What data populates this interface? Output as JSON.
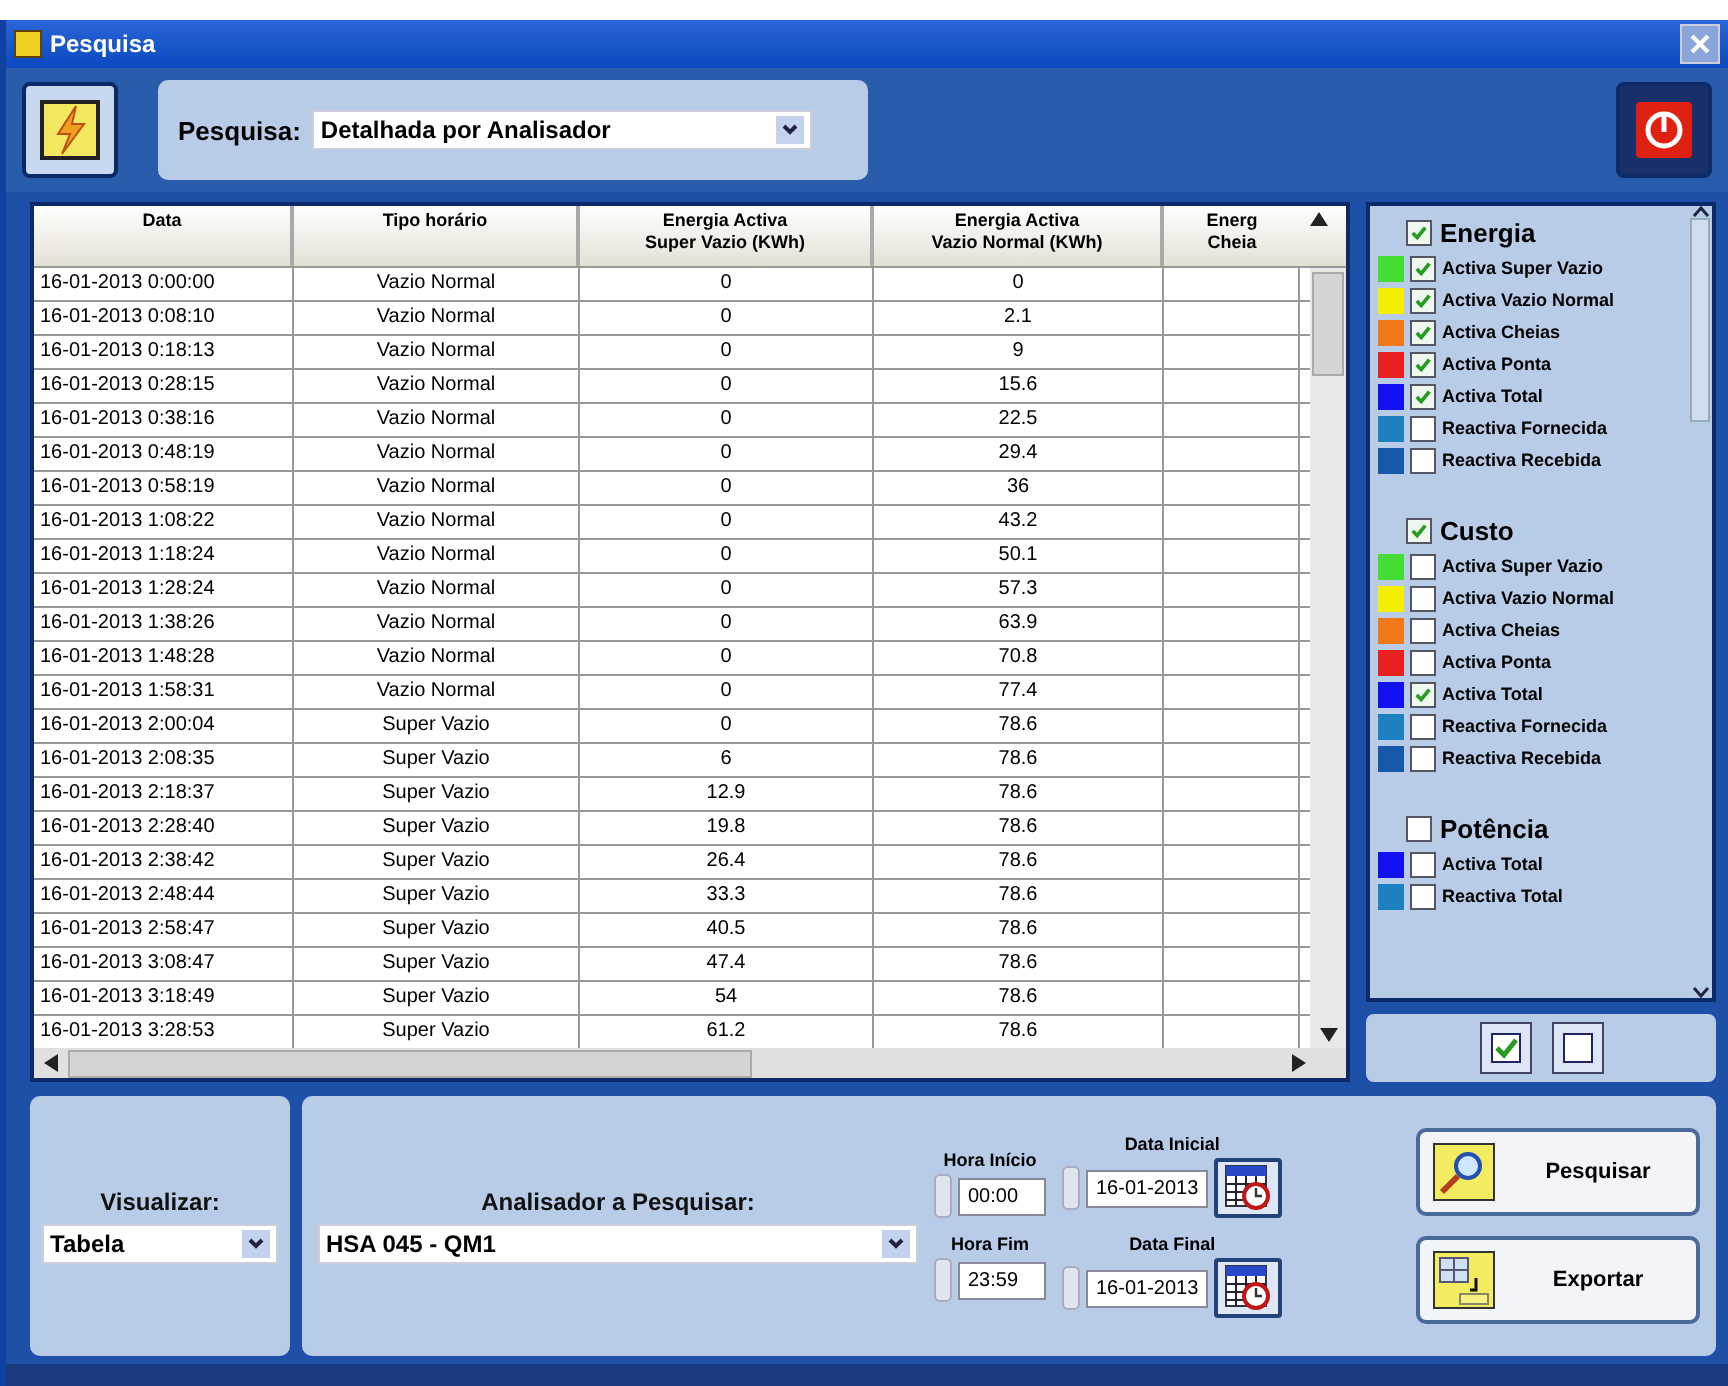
{
  "window": {
    "title": "Pesquisa"
  },
  "toolbar": {
    "label": "Pesquisa:",
    "value": "Detalhada por Analisador"
  },
  "table": {
    "columns": [
      "Data",
      "Tipo horário",
      "Energia Activa\nSuper Vazio (KWh)",
      "Energia Activa\nVazio Normal (KWh)",
      "Energ\nCheia"
    ],
    "rows": [
      [
        "16-01-2013 0:00:00",
        "Vazio Normal",
        "0",
        "0"
      ],
      [
        "16-01-2013 0:08:10",
        "Vazio Normal",
        "0",
        "2.1"
      ],
      [
        "16-01-2013 0:18:13",
        "Vazio Normal",
        "0",
        "9"
      ],
      [
        "16-01-2013 0:28:15",
        "Vazio Normal",
        "0",
        "15.6"
      ],
      [
        "16-01-2013 0:38:16",
        "Vazio Normal",
        "0",
        "22.5"
      ],
      [
        "16-01-2013 0:48:19",
        "Vazio Normal",
        "0",
        "29.4"
      ],
      [
        "16-01-2013 0:58:19",
        "Vazio Normal",
        "0",
        "36"
      ],
      [
        "16-01-2013 1:08:22",
        "Vazio Normal",
        "0",
        "43.2"
      ],
      [
        "16-01-2013 1:18:24",
        "Vazio Normal",
        "0",
        "50.1"
      ],
      [
        "16-01-2013 1:28:24",
        "Vazio Normal",
        "0",
        "57.3"
      ],
      [
        "16-01-2013 1:38:26",
        "Vazio Normal",
        "0",
        "63.9"
      ],
      [
        "16-01-2013 1:48:28",
        "Vazio Normal",
        "0",
        "70.8"
      ],
      [
        "16-01-2013 1:58:31",
        "Vazio Normal",
        "0",
        "77.4"
      ],
      [
        "16-01-2013 2:00:04",
        "Super Vazio",
        "0",
        "78.6"
      ],
      [
        "16-01-2013 2:08:35",
        "Super Vazio",
        "6",
        "78.6"
      ],
      [
        "16-01-2013 2:18:37",
        "Super Vazio",
        "12.9",
        "78.6"
      ],
      [
        "16-01-2013 2:28:40",
        "Super Vazio",
        "19.8",
        "78.6"
      ],
      [
        "16-01-2013 2:38:42",
        "Super Vazio",
        "26.4",
        "78.6"
      ],
      [
        "16-01-2013 2:48:44",
        "Super Vazio",
        "33.3",
        "78.6"
      ],
      [
        "16-01-2013 2:58:47",
        "Super Vazio",
        "40.5",
        "78.6"
      ],
      [
        "16-01-2013 3:08:47",
        "Super Vazio",
        "47.4",
        "78.6"
      ],
      [
        "16-01-2013 3:18:49",
        "Super Vazio",
        "54",
        "78.6"
      ],
      [
        "16-01-2013 3:28:53",
        "Super Vazio",
        "61.2",
        "78.6"
      ]
    ]
  },
  "legend": [
    {
      "title": "Energia",
      "checked": true,
      "items": [
        {
          "label": "Activa Super Vazio",
          "checked": true,
          "color": "#44dd33"
        },
        {
          "label": "Activa Vazio Normal",
          "checked": true,
          "color": "#f4ee00"
        },
        {
          "label": "Activa Cheias",
          "checked": true,
          "color": "#f07818"
        },
        {
          "label": "Activa Ponta",
          "checked": true,
          "color": "#e82020"
        },
        {
          "label": "Activa Total",
          "checked": true,
          "color": "#1010f0"
        },
        {
          "label": "Reactiva Fornecida",
          "checked": false,
          "color": "#1c80c0"
        },
        {
          "label": "Reactiva Recebida",
          "checked": false,
          "color": "#1858a8"
        }
      ]
    },
    {
      "title": "Custo",
      "checked": true,
      "items": [
        {
          "label": "Activa Super Vazio",
          "checked": false,
          "color": "#44dd33"
        },
        {
          "label": "Activa Vazio Normal",
          "checked": false,
          "color": "#f4ee00"
        },
        {
          "label": "Activa Cheias",
          "checked": false,
          "color": "#f07818"
        },
        {
          "label": "Activa Ponta",
          "checked": false,
          "color": "#e82020"
        },
        {
          "label": "Activa Total",
          "checked": true,
          "color": "#1010f0"
        },
        {
          "label": "Reactiva Fornecida",
          "checked": false,
          "color": "#1c80c0"
        },
        {
          "label": "Reactiva Recebida",
          "checked": false,
          "color": "#1858a8"
        }
      ]
    },
    {
      "title": "Potência",
      "checked": false,
      "items": [
        {
          "label": "Activa Total",
          "checked": false,
          "color": "#1010f0"
        },
        {
          "label": "Reactiva Total",
          "checked": false,
          "color": "#1c80c0"
        }
      ]
    }
  ],
  "view": {
    "label": "Visualizar:",
    "value": "Tabela"
  },
  "analyzer": {
    "label": "Analisador a Pesquisar:",
    "value": "HSA 045 - QM1"
  },
  "times": [
    {
      "label": "Hora Início",
      "value": "00:00"
    },
    {
      "label": "Hora Fim",
      "value": "23:59"
    }
  ],
  "dates": [
    {
      "label": "Data Inicial",
      "value": "16-01-2013"
    },
    {
      "label": "Data Final",
      "value": "16-01-2013"
    }
  ],
  "actions": [
    {
      "kind": "search",
      "label": "Pesquisar"
    },
    {
      "kind": "export",
      "label": "Exportar"
    }
  ]
}
